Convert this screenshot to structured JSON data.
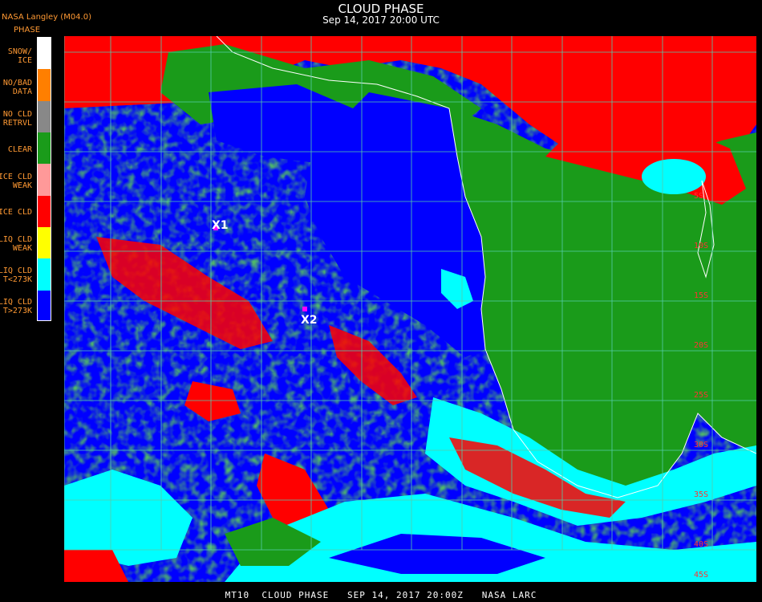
{
  "header": {
    "title": "CLOUD PHASE",
    "subtitle": "Sep 14, 2017 20:00 UTC",
    "producer": "NASA Langley (M04.0)",
    "colorbar_title": "PHASE"
  },
  "legend": [
    {
      "label": "SNOW/\nICE",
      "color": "#ffffff"
    },
    {
      "label": "NO/BAD\nDATA",
      "color": "#ff7f00"
    },
    {
      "label": "NO CLD\nRETRVL",
      "color": "#888888"
    },
    {
      "label": "CLEAR",
      "color": "#1a9b1a"
    },
    {
      "label": "ICE CLD\nWEAK",
      "color": "#ff9999"
    },
    {
      "label": "ICE CLD",
      "color": "#ff0000"
    },
    {
      "label": "LIQ CLD\nWEAK",
      "color": "#ffff00"
    },
    {
      "label": "LIQ CLD\nT<273K",
      "color": "#00ffff"
    },
    {
      "label": "LIQ CLD\nT>273K",
      "color": "#0000ff"
    }
  ],
  "map": {
    "grid_color": "#55ccaa",
    "coast_color": "#ffffff",
    "lat_labels": [
      "5S",
      "10S",
      "15S",
      "20S",
      "25S",
      "30S",
      "35S",
      "40S",
      "45S"
    ],
    "markers": [
      {
        "label": "X1",
        "color": "#ff00ff"
      },
      {
        "label": "X2",
        "color": "#ff00ff"
      }
    ]
  },
  "footer": "MT10  CLOUD PHASE   SEP 14, 2017 20:00Z   NASA LARC"
}
